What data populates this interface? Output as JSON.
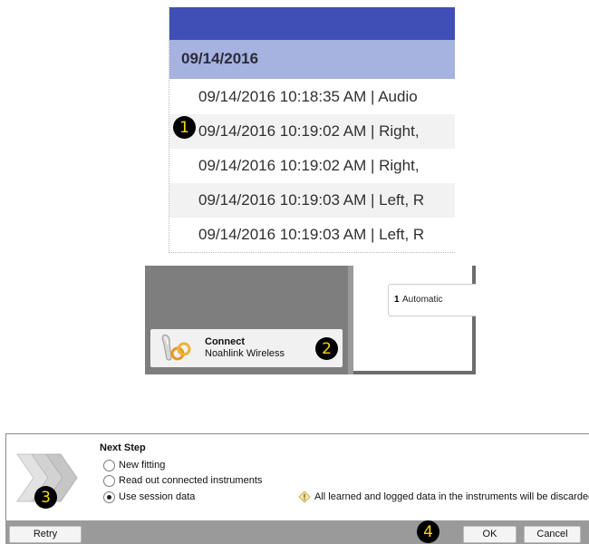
{
  "badges": [
    "1",
    "2",
    "3",
    "4"
  ],
  "log_panel": {
    "date_header": "09/14/2016",
    "entries": [
      "09/14/2016 10:18:35 AM | Audio",
      "09/14/2016 10:19:02 AM | Right,",
      "09/14/2016 10:19:02 AM | Right,",
      "09/14/2016 10:19:03 AM | Left, R",
      "09/14/2016 10:19:03 AM | Left, R"
    ],
    "colors": {
      "top_bar": "#3f4fb5",
      "date_header_bg": "#a6b2df"
    }
  },
  "connect_panel": {
    "program_number": "1",
    "program_name": "Automatic",
    "connect_title": "Connect",
    "connect_device": "Noahlink Wireless",
    "icon": "hearing-aid-link-icon"
  },
  "next_step_panel": {
    "title": "Next Step",
    "options": [
      {
        "label": "New fitting",
        "selected": false
      },
      {
        "label": "Read out connected instruments",
        "selected": false
      },
      {
        "label": "Use session data",
        "selected": true
      }
    ],
    "warning": "All learned and logged data in the instruments will be discarded!",
    "buttons": {
      "retry": "Retry",
      "ok": "OK",
      "cancel": "Cancel"
    },
    "icon": "chevron-arrows-icon"
  }
}
